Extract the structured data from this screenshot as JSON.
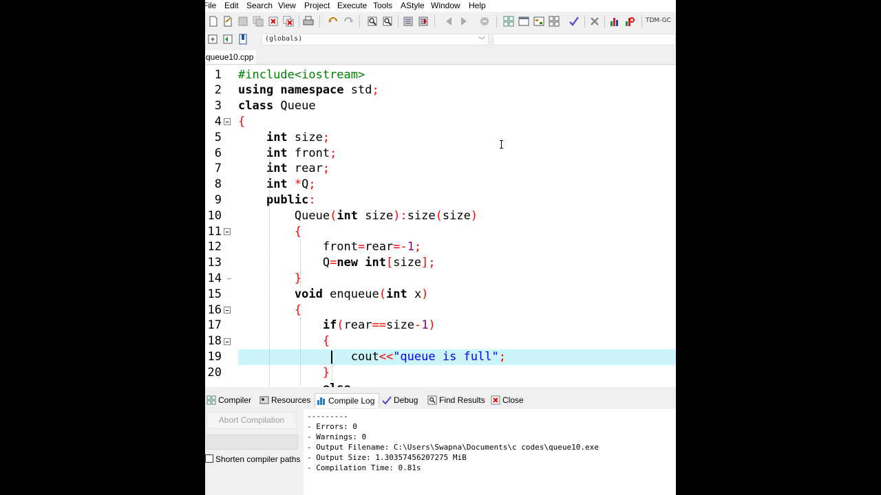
{
  "menu": [
    "File",
    "Edit",
    "Search",
    "View",
    "Project",
    "Execute",
    "Tools",
    "AStyle",
    "Window",
    "Help"
  ],
  "toolbar": {
    "compiler_set": "TDM-GC"
  },
  "scope_selector": {
    "value": "(globals)"
  },
  "file_tab": "queue10.cpp",
  "editor": {
    "line_numbers": [
      "1",
      "2",
      "3",
      "4",
      "5",
      "6",
      "7",
      "8",
      "9",
      "10",
      "11",
      "12",
      "13",
      "14",
      "15",
      "16",
      "17",
      "18",
      "19",
      "20"
    ],
    "active_line": 19
  },
  "bottom_tabs": [
    "Compiler",
    "Resources",
    "Compile Log",
    "Debug",
    "Find Results",
    "Close"
  ],
  "selected_bottom_tab": "Compile Log",
  "compile_panel": {
    "abort_label": "Abort Compilation",
    "shorten_label": "Shorten compiler paths",
    "log": [
      "---------",
      "- Errors: 0",
      "- Warnings: 0",
      "- Output Filename: C:\\Users\\Swapna\\Documents\\c codes\\queue10.exe",
      "- Output Size: 1.30357456207275 MiB",
      "- Compilation Time: 0.81s"
    ]
  },
  "colors": {
    "active_line": "#ccf5fa",
    "keyword": "#000000",
    "string": "#0000ff",
    "number": "#800080",
    "symbol": "#ff0000",
    "preprocessor": "#008000"
  }
}
